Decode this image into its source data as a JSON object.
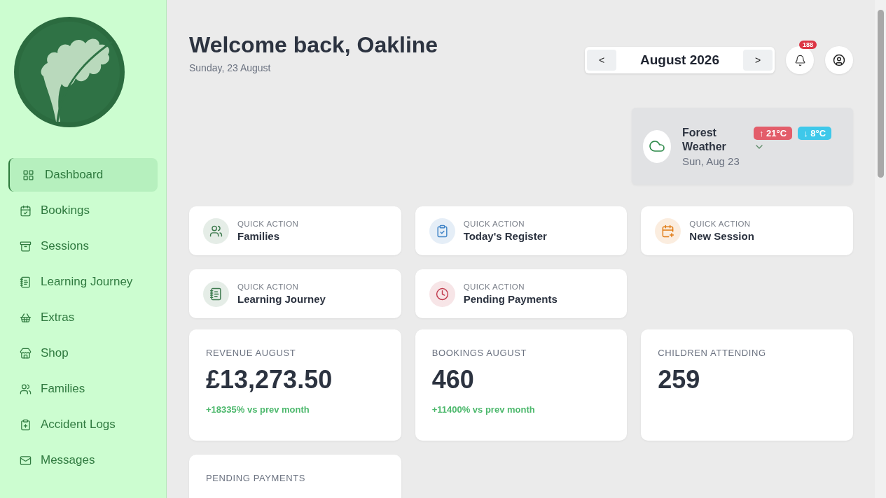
{
  "sidebar": {
    "items": [
      {
        "label": "Dashboard",
        "selected": true
      },
      {
        "label": "Bookings",
        "selected": false
      },
      {
        "label": "Sessions",
        "selected": false
      },
      {
        "label": "Learning Journey",
        "selected": false
      },
      {
        "label": "Extras",
        "selected": false
      },
      {
        "label": "Shop",
        "selected": false
      },
      {
        "label": "Families",
        "selected": false
      },
      {
        "label": "Accident Logs",
        "selected": false
      },
      {
        "label": "Messages",
        "selected": false
      }
    ]
  },
  "header": {
    "title": "Welcome back, Oakline",
    "date": "Sunday, 23 August",
    "month": "August 2026",
    "prev": "<",
    "next": ">",
    "notifications": "188"
  },
  "weather": {
    "title": "Forest Weather",
    "date": "Sun, Aug 23",
    "high": "↑ 21°C",
    "low": "↓ 8°C"
  },
  "quick_actions": [
    {
      "overline": "QUICK ACTION",
      "label": "Families",
      "color": "#3d7a4e"
    },
    {
      "overline": "QUICK ACTION",
      "label": "Today's Register",
      "color": "#3f83c6"
    },
    {
      "overline": "QUICK ACTION",
      "label": "New Session",
      "color": "#e07a12"
    },
    {
      "overline": "QUICK ACTION",
      "label": "Learning Journey",
      "color": "#3d7a4e"
    },
    {
      "overline": "QUICK ACTION",
      "label": "Pending Payments",
      "color": "#c0394b"
    }
  ],
  "stats": [
    {
      "label": "REVENUE AUGUST",
      "value": "£13,273.50",
      "change": "+18335% vs prev month"
    },
    {
      "label": "BOOKINGS AUGUST",
      "value": "460",
      "change": "+11400% vs prev month"
    },
    {
      "label": "CHILDREN ATTENDING",
      "value": "259"
    },
    {
      "label": "PENDING PAYMENTS"
    }
  ]
}
